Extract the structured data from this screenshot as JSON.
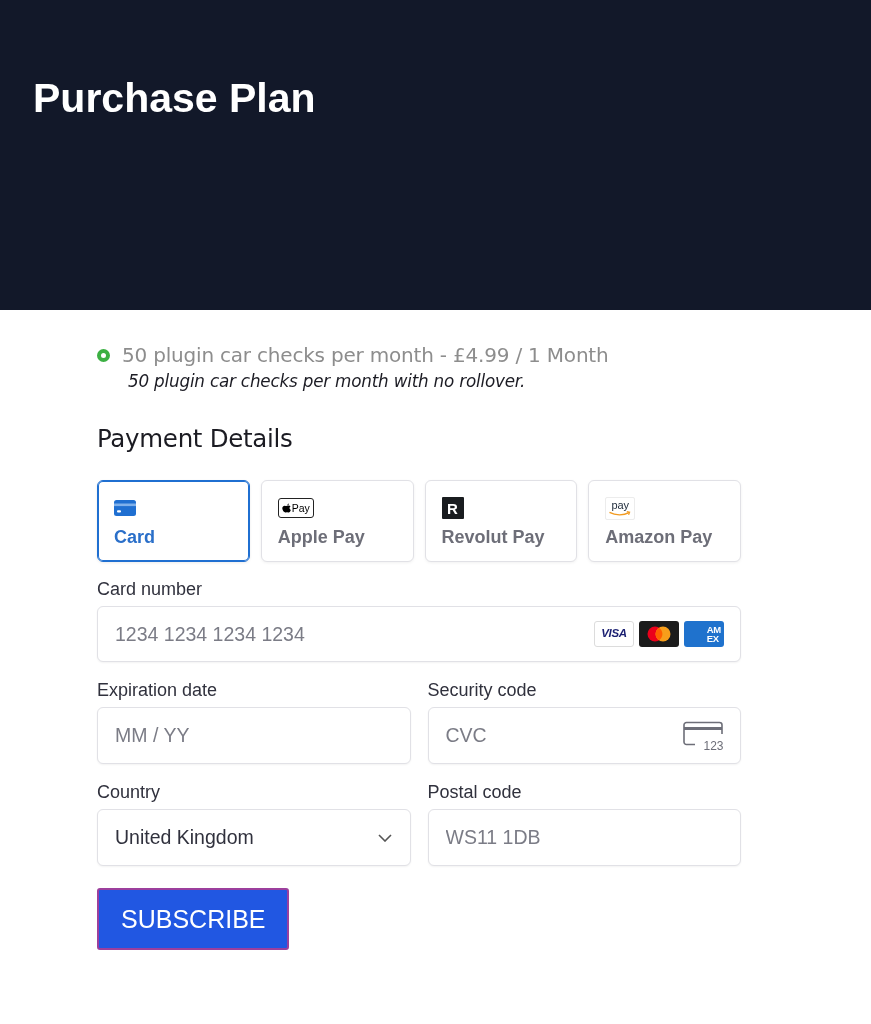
{
  "header": {
    "title": "Purchase Plan"
  },
  "plans": [
    {
      "label": "50 plugin car checks per month - £4.99 / 1 Month",
      "description": "50 plugin car checks per month with no rollover.",
      "selected": true
    }
  ],
  "payment": {
    "heading": "Payment Details",
    "methods": [
      {
        "kind": "card",
        "label": "Card",
        "selected": true
      },
      {
        "kind": "apple_pay",
        "label": "Apple Pay",
        "logo_text": "Pay",
        "selected": false
      },
      {
        "kind": "revolut_pay",
        "label": "Revolut Pay",
        "logo_text": "R",
        "selected": false
      },
      {
        "kind": "amazon_pay",
        "label": "Amazon Pay",
        "logo_text": "pay",
        "selected": false
      }
    ],
    "fields": [
      {
        "kind": "card_number",
        "label": "Card number",
        "placeholder": "1234 1234 1234 1234",
        "brands": [
          {
            "kind": "visa",
            "text": "VISA"
          },
          {
            "kind": "mastercard"
          },
          {
            "kind": "amex",
            "lines": [
              "AM",
              "EX"
            ]
          }
        ]
      },
      {
        "kind": "expiry",
        "label": "Expiration date",
        "placeholder": "MM / YY"
      },
      {
        "kind": "cvc",
        "label": "Security code",
        "placeholder": "CVC",
        "icon_text": "123"
      },
      {
        "kind": "select",
        "label": "Country",
        "value": "United Kingdom"
      },
      {
        "kind": "postal",
        "label": "Postal code",
        "placeholder": "WS11 1DB"
      }
    ]
  },
  "button": {
    "label": "SUBSCRIBE"
  }
}
